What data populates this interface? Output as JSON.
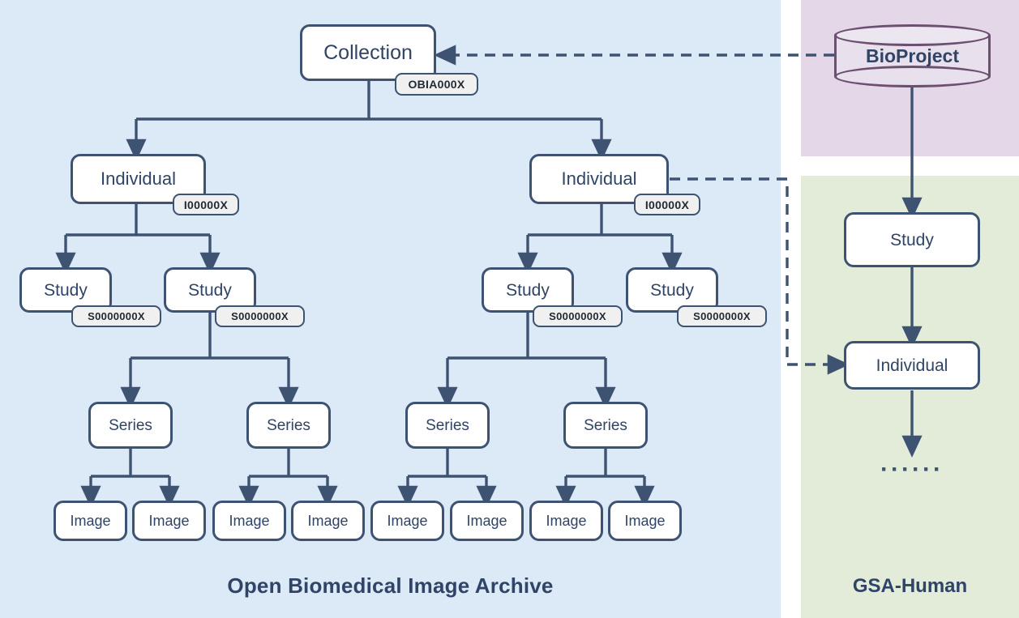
{
  "panels": {
    "obia": {
      "title": "Open Biomedical Image Archive",
      "bg": "#dce9f7",
      "text_color": "#2f4466"
    },
    "bioproject": {
      "bg": "#e4d8e8"
    },
    "gsa": {
      "title": "GSA-Human",
      "bg": "#e2ecd9",
      "text_color": "#2f4466"
    }
  },
  "colors": {
    "node_border": "#3e5272",
    "node_fill": "#ffffff",
    "chip_fill": "#f0f0f0",
    "cylinder_border": "#6d4f72",
    "cylinder_fill": "#e8e0ec",
    "connector": "#3e5272",
    "label_text": "#2f4466"
  },
  "obia_nodes": {
    "collection": {
      "label": "Collection",
      "id_chip": "OBIA000X"
    },
    "individual_left": {
      "label": "Individual",
      "id_chip": "I00000X"
    },
    "individual_right": {
      "label": "Individual",
      "id_chip": "I00000X"
    },
    "study_1": {
      "label": "Study",
      "id_chip": "S0000000X"
    },
    "study_2": {
      "label": "Study",
      "id_chip": "S0000000X"
    },
    "study_3": {
      "label": "Study",
      "id_chip": "S0000000X"
    },
    "study_4": {
      "label": "Study",
      "id_chip": "S0000000X"
    },
    "series": [
      {
        "label": "Series"
      },
      {
        "label": "Series"
      },
      {
        "label": "Series"
      },
      {
        "label": "Series"
      }
    ],
    "images": [
      {
        "label": "Image"
      },
      {
        "label": "Image"
      },
      {
        "label": "Image"
      },
      {
        "label": "Image"
      },
      {
        "label": "Image"
      },
      {
        "label": "Image"
      },
      {
        "label": "Image"
      },
      {
        "label": "Image"
      }
    ]
  },
  "external_nodes": {
    "bioproject": {
      "label": "BioProject",
      "shape": "cylinder-database"
    },
    "gsa_study": {
      "label": "Study"
    },
    "gsa_individual": {
      "label": "Individual"
    },
    "gsa_ellipsis": {
      "label": "······"
    }
  },
  "edges": {
    "bioproject_to_collection": {
      "style": "dashed",
      "direction": "right-to-left"
    },
    "bioproject_to_gsa_study": {
      "style": "solid",
      "direction": "top-to-bottom"
    },
    "gsa_study_to_gsa_individual": {
      "style": "solid",
      "direction": "top-to-bottom"
    },
    "gsa_individual_to_ellipsis": {
      "style": "solid",
      "direction": "top-to-bottom"
    },
    "obia_individual_to_gsa_individual": {
      "style": "dashed",
      "direction": "left-to-right"
    }
  }
}
